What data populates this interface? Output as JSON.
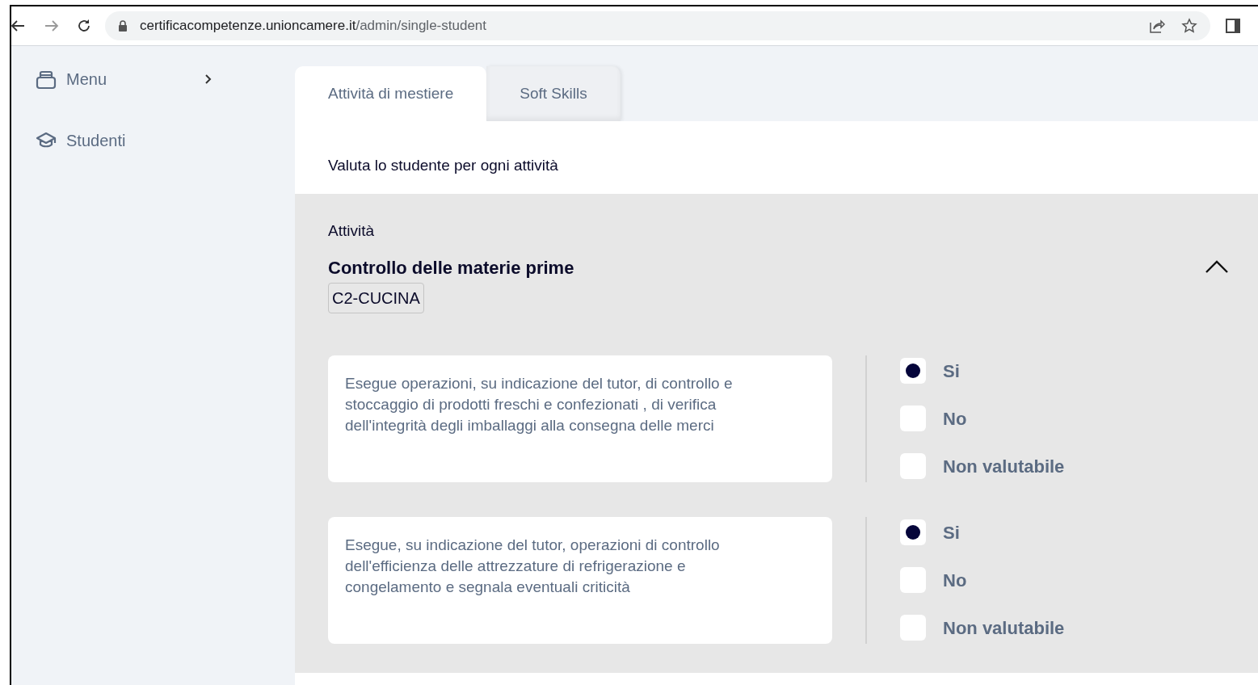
{
  "browser": {
    "url_host": "certificacompetenze.unioncamere.it",
    "url_path": "/admin/single-student"
  },
  "sidebar": {
    "items": [
      {
        "label": "Menu",
        "kind": "menu"
      },
      {
        "label": "Studenti",
        "kind": "students"
      }
    ]
  },
  "tabs": [
    {
      "label": "Attività di mestiere",
      "selected": true
    },
    {
      "label": "Soft Skills",
      "selected": false
    }
  ],
  "instruction": "Valuta lo studente per ogni attività",
  "activity": {
    "label": "Attività",
    "title": "Controllo delle materie prime",
    "tag": "C2-CUCINA",
    "expanded": true,
    "items": [
      {
        "text": "Esegue operazioni, su indicazione del tutor, di controllo e stoccaggio di prodotti freschi e confezionati , di verifica dell'integrità degli imballaggi alla consegna delle merci",
        "options": [
          {
            "label": "Si",
            "selected": true
          },
          {
            "label": "No",
            "selected": false
          },
          {
            "label": "Non valutabile",
            "selected": false
          }
        ]
      },
      {
        "text": "Esegue, su indicazione del tutor, operazioni di controllo dell'efficienza delle attrezzature di refrigerazione e congelamento e segnala eventuali criticità",
        "options": [
          {
            "label": "Si",
            "selected": true
          },
          {
            "label": "No",
            "selected": false
          },
          {
            "label": "Non valutabile",
            "selected": false
          }
        ]
      }
    ]
  }
}
